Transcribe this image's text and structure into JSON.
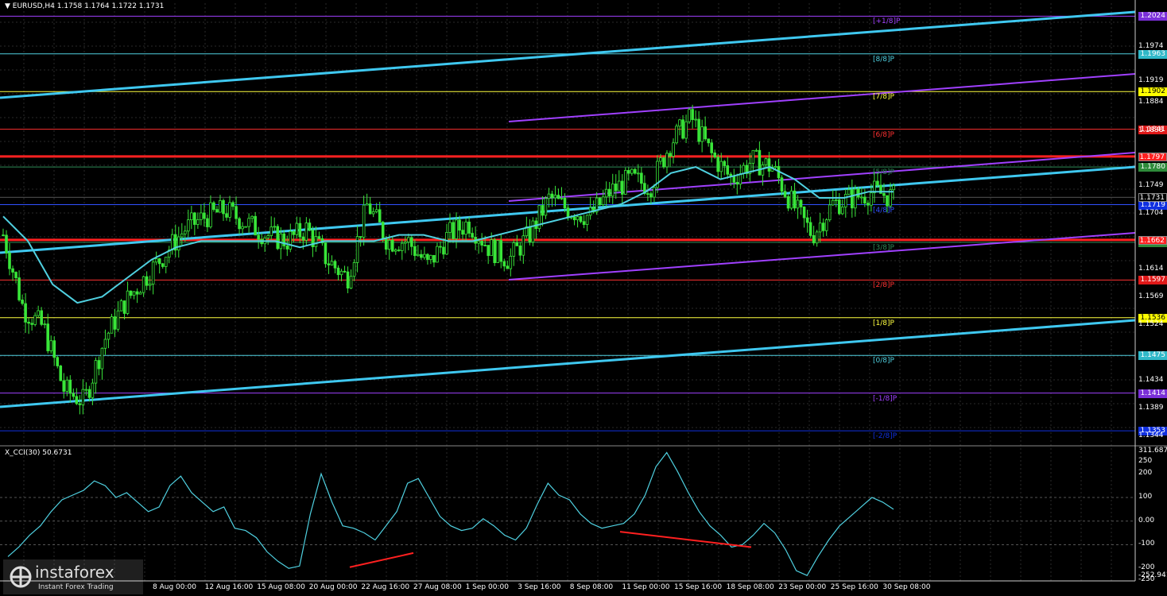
{
  "header": {
    "title": "▼ EURUSD,H4  1.1758 1.1764 1.1722 1.1731"
  },
  "cci": {
    "title": "X_CCI(30) 50.6731",
    "max_label": "311.6879",
    "min_label": "-252.941"
  },
  "watermark": {
    "brand": "instaforex",
    "sub": "Instant Forex Trading"
  },
  "price_axis": [
    "1.1974",
    "1.1919",
    "1.1884",
    "1.1838",
    "1.1749",
    "1.1704",
    "1.1614",
    "1.1569",
    "1.1524",
    "1.1434",
    "1.1389",
    "1.1344"
  ],
  "cci_axis": [
    "250",
    "200",
    "100",
    "0.00",
    "-100",
    "-200",
    "-250"
  ],
  "x_labels": [
    "8 Aug 00:00",
    "12 Aug 16:00",
    "15 Aug 08:00",
    "20 Aug 00:00",
    "22 Aug 16:00",
    "27 Aug 08:00",
    "1 Sep 00:00",
    "3 Sep 16:00",
    "8 Sep 08:00",
    "11 Sep 00:00",
    "15 Sep 16:00",
    "18 Sep 08:00",
    "23 Sep 00:00",
    "25 Sep 16:00",
    "30 Sep 08:00"
  ],
  "levels": [
    {
      "label": "[+1/8]P",
      "value": "1.2024",
      "color": "#a040ff",
      "tag_bg": "#7a2fd8",
      "tag_fg": "#fff"
    },
    {
      "label": "[8/8]P",
      "value": "1.1963",
      "color": "#4fd0e0",
      "tag_bg": "#30b8c8",
      "tag_fg": "#fff"
    },
    {
      "label": "[7/8]P",
      "value": "1.1902",
      "color": "#ffff40",
      "tag_bg": "#ffff00",
      "tag_fg": "#000"
    },
    {
      "label": "[6/8]P",
      "value": "1.1841",
      "color": "#ff3030",
      "tag_bg": "#e01818",
      "tag_fg": "#fff"
    },
    {
      "label": "[5/8]P",
      "value": "1.1780",
      "color": "#2e8b57",
      "tag_bg": "#2e8b3a",
      "tag_fg": "#fff"
    },
    {
      "label": "[4/8]P",
      "value": "1.1719",
      "color": "#3050ff",
      "tag_bg": "#1030e0",
      "tag_fg": "#fff"
    },
    {
      "label": "[3/8]P",
      "value": "1.1658",
      "color": "#2e8b57",
      "tag_bg": "#2e8b3a",
      "tag_fg": "#fff"
    },
    {
      "label": "[2/8]P",
      "value": "1.1597",
      "color": "#ff3030",
      "tag_bg": "#e01818",
      "tag_fg": "#fff"
    },
    {
      "label": "[1/8]P",
      "value": "1.1536",
      "color": "#ffff40",
      "tag_bg": "#ffff00",
      "tag_fg": "#000"
    },
    {
      "label": "[0/8]P",
      "value": "1.1475",
      "color": "#4fd0e0",
      "tag_bg": "#30b8c8",
      "tag_fg": "#fff"
    },
    {
      "label": "[-1/8]P",
      "value": "1.1414",
      "color": "#a040ff",
      "tag_bg": "#7a2fd8",
      "tag_fg": "#fff"
    },
    {
      "label": "[-2/8]P",
      "value": "1.1353",
      "color": "#1030e0",
      "tag_bg": "#1030e0",
      "tag_fg": "#fff"
    }
  ],
  "extra_tags": [
    {
      "value": "1.1797",
      "tag_bg": "#ff2020",
      "tag_fg": "#fff"
    },
    {
      "value": "1.1731",
      "tag_bg": "#000",
      "tag_fg": "#fff"
    },
    {
      "value": "1.1662",
      "tag_bg": "#ff2020",
      "tag_fg": "#fff"
    }
  ],
  "chart_data": [
    {
      "type": "candlestick",
      "title": "EURUSD,H4",
      "ohlc_last": {
        "open": 1.1758,
        "high": 1.1764,
        "low": 1.1722,
        "close": 1.1731
      },
      "ylim": [
        1.133,
        1.2045
      ],
      "x": [
        "8 Aug 00:00",
        "12 Aug 16:00",
        "15 Aug 08:00",
        "20 Aug 00:00",
        "22 Aug 16:00",
        "27 Aug 08:00",
        "1 Sep 00:00",
        "3 Sep 16:00",
        "8 Sep 08:00",
        "11 Sep 00:00",
        "15 Sep 16:00",
        "18 Sep 08:00",
        "23 Sep 00:00",
        "25 Sep 16:00",
        "30 Sep 08:00"
      ],
      "close_path": [
        1.167,
        1.155,
        1.152,
        1.142,
        1.14,
        1.15,
        1.156,
        1.16,
        1.164,
        1.168,
        1.17,
        1.171,
        1.169,
        1.167,
        1.166,
        1.168,
        1.163,
        1.16,
        1.172,
        1.166,
        1.166,
        1.162,
        1.167,
        1.169,
        1.165,
        1.163,
        1.167,
        1.173,
        1.171,
        1.17,
        1.174,
        1.176,
        1.175,
        1.182,
        1.186,
        1.18,
        1.176,
        1.179,
        1.178,
        1.172,
        1.167,
        1.172,
        1.173,
        1.174,
        1.1731
      ],
      "moving_average": [
        1.17,
        1.166,
        1.159,
        1.156,
        1.157,
        1.16,
        1.163,
        1.165,
        1.166,
        1.166,
        1.166,
        1.166,
        1.165,
        1.166,
        1.166,
        1.166,
        1.167,
        1.167,
        1.166,
        1.166,
        1.167,
        1.168,
        1.169,
        1.17,
        1.171,
        1.172,
        1.174,
        1.177,
        1.178,
        1.176,
        1.177,
        1.178,
        1.176,
        1.173,
        1.173,
        1.174,
        1.174
      ],
      "horizontal_lines": [
        1.1797,
        1.1662
      ],
      "current_price": 1.1731
    },
    {
      "type": "line",
      "title": "X_CCI(30)",
      "current": 50.6731,
      "ylim": [
        -252.941,
        311.6879
      ],
      "y_ticks": [
        250,
        200,
        100,
        0,
        -100,
        -200,
        -250
      ],
      "values": [
        -150,
        -110,
        -60,
        -20,
        40,
        90,
        110,
        130,
        170,
        150,
        100,
        120,
        80,
        40,
        60,
        150,
        190,
        120,
        80,
        40,
        60,
        -30,
        -40,
        -70,
        -130,
        -170,
        -200,
        -190,
        30,
        200,
        80,
        -20,
        -30,
        -50,
        -80,
        -20,
        40,
        160,
        180,
        100,
        20,
        -20,
        -40,
        -30,
        10,
        -20,
        -60,
        -80,
        -30,
        70,
        160,
        110,
        90,
        30,
        -10,
        -30,
        -20,
        -10,
        30,
        110,
        230,
        290,
        210,
        120,
        40,
        -20,
        -60,
        -110,
        -100,
        -60,
        -10,
        -50,
        -120,
        -210,
        -230,
        -150,
        -80,
        -20,
        20,
        60,
        100,
        80,
        50
      ]
    }
  ]
}
